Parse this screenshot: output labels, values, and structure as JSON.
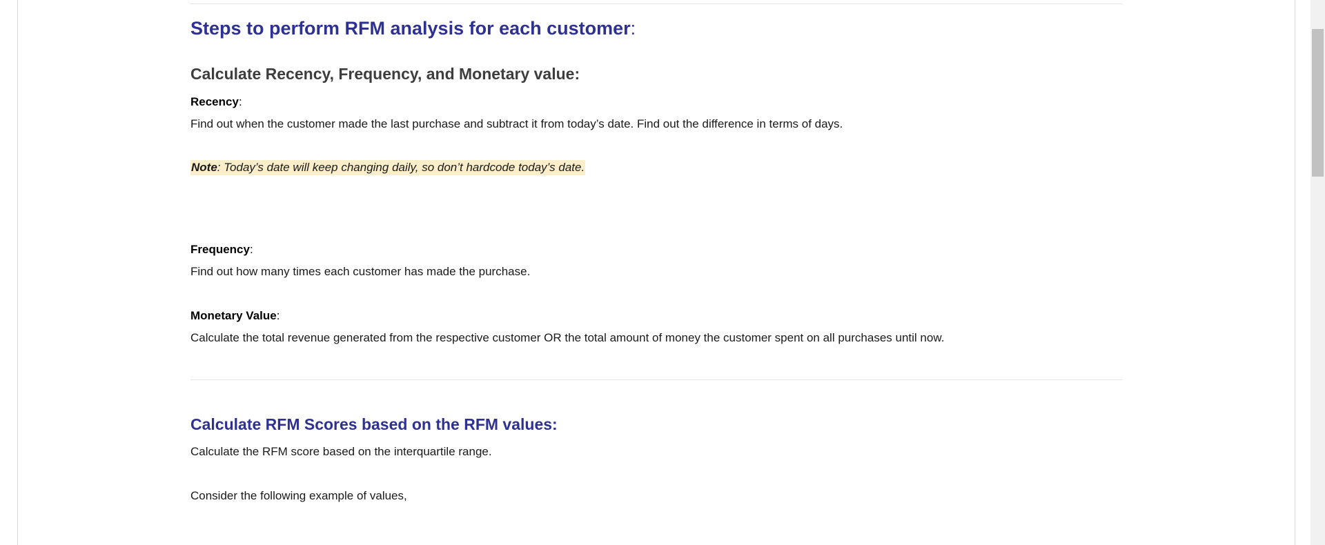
{
  "section1": {
    "heading": "Steps to perform RFM analysis for each customer",
    "heading_colon": ":",
    "subheading": "Calculate Recency, Frequency, and Monetary value:"
  },
  "recency": {
    "term": "Recency",
    "colon": ":",
    "description": "Find out when the customer made the last purchase and subtract it from today’s date. Find out the difference in terms of days.",
    "note_label": "Note",
    "note_text": ": Today’s date will keep changing daily, so don’t hardcode today’s date."
  },
  "frequency": {
    "term": "Frequency",
    "colon": ":",
    "description": "Find out how many times each customer has made the purchase."
  },
  "monetary": {
    "term": "Monetary Value",
    "colon": ":",
    "description": "Calculate the total revenue generated from the respective customer OR the total amount of money the customer spent on all purchases until now."
  },
  "section2": {
    "heading": "Calculate RFM Scores based on the RFM values:",
    "description": "Calculate the RFM score based on the interquartile range.",
    "example_intro": "Consider the following example of values,"
  },
  "colors": {
    "heading_blue": "#2e3192",
    "subheading_gray": "#3d3d3d",
    "note_highlight": "#fbefcb",
    "divider": "#e3e3e3"
  }
}
